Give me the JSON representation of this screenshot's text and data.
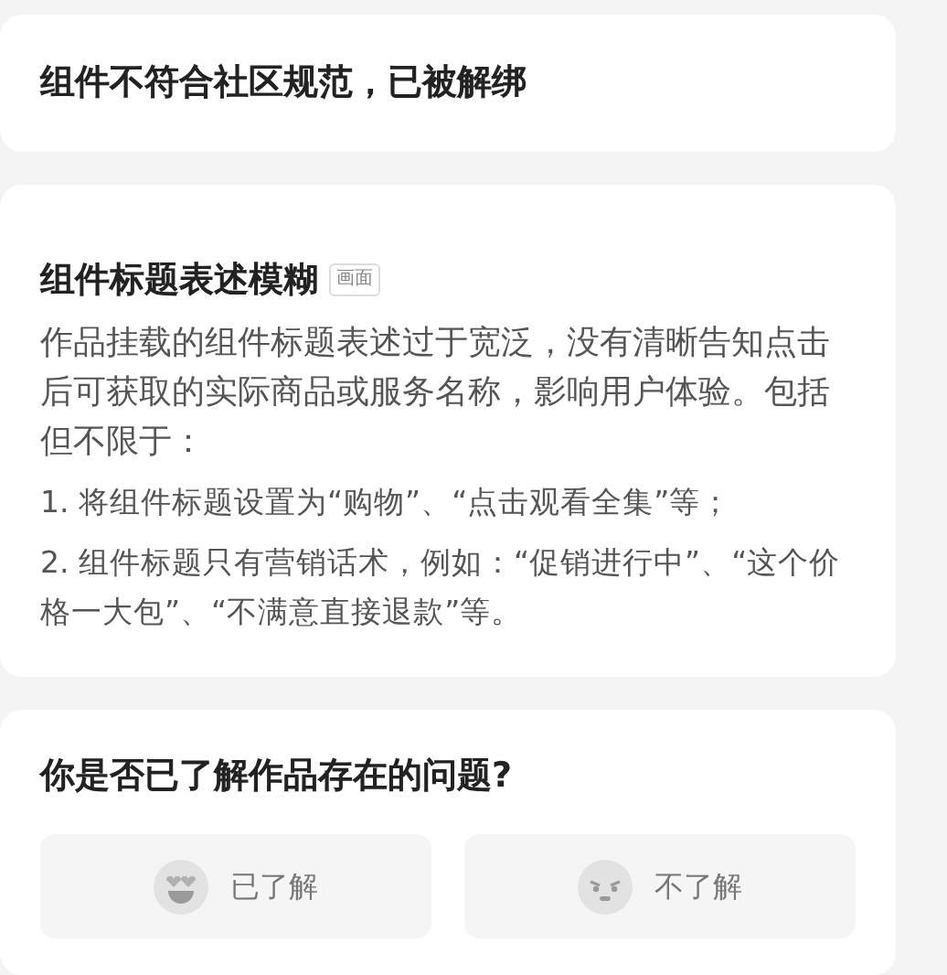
{
  "notice": {
    "title": "组件不符合社区规范，已被解绑"
  },
  "rule": {
    "title": "组件标题表述模糊",
    "tag": "画面",
    "description": "作品挂载的组件标题表述过于宽泛，没有清晰告知点击后可获取的实际商品或服务名称，影响用户体验。包括但不限于：",
    "items": [
      "1. 将组件标题设置为“购物”、“点击观看全集”等；",
      "2. 组件标题只有营销话术，例如：“促销进行中”、“这个价格一大包”、“不满意直接退款”等。"
    ]
  },
  "question": {
    "title": "你是否已了解作品存在的问题?",
    "options": [
      {
        "label": "已了解",
        "kind": "happy"
      },
      {
        "label": "不了解",
        "kind": "sad"
      }
    ]
  }
}
